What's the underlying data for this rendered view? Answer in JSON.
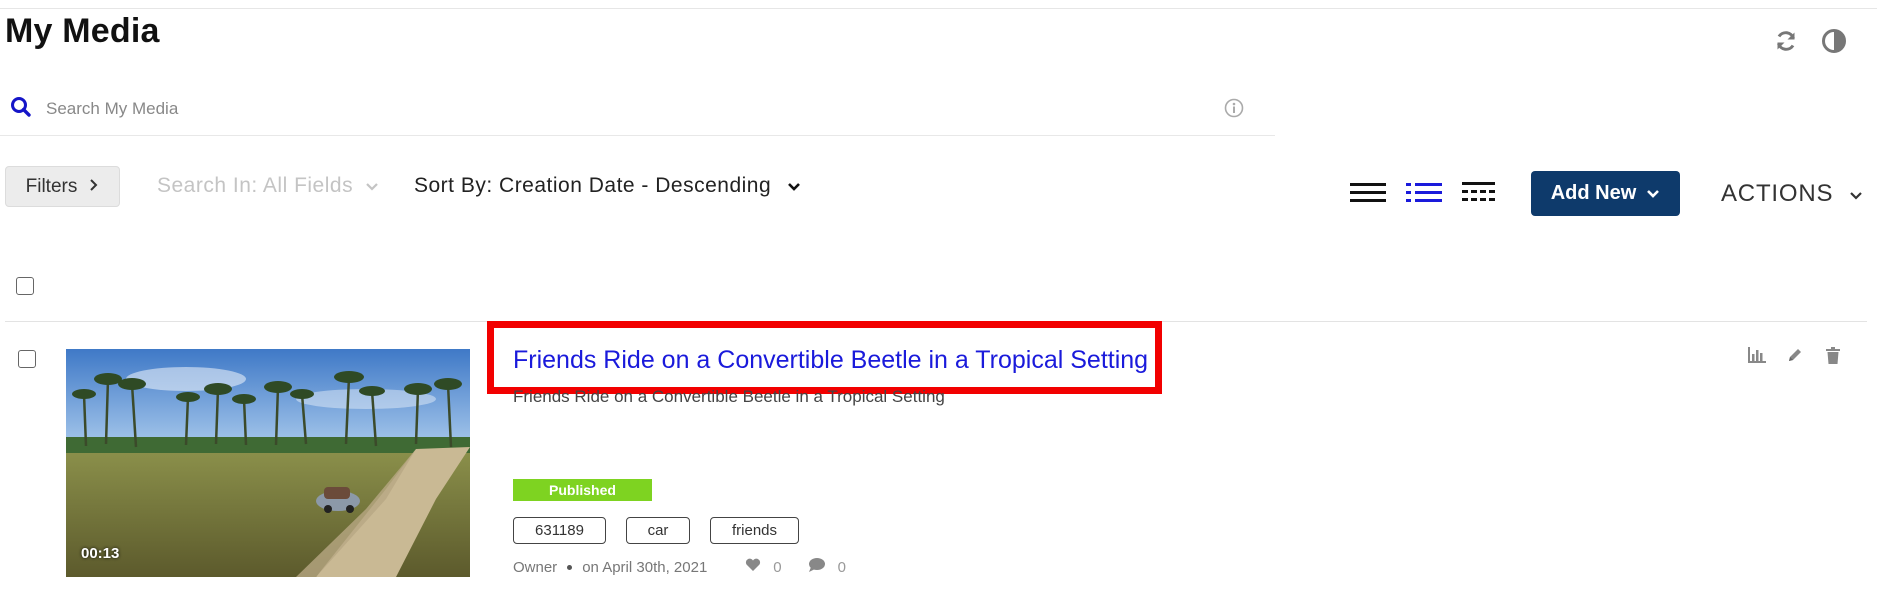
{
  "page": {
    "title": "My Media"
  },
  "header_icons": {
    "refresh": "refresh-icon",
    "contrast": "contrast-icon"
  },
  "search": {
    "placeholder": "Search My Media",
    "value": ""
  },
  "toolbar": {
    "filters_label": "Filters",
    "search_in_label": "Search In: All Fields",
    "sort_by_label": "Sort By: Creation Date - Descending",
    "add_new_label": "Add New",
    "actions_label": "ACTIONS",
    "view_modes": [
      "compact-list",
      "detailed-list",
      "table"
    ],
    "active_view": "detailed-list"
  },
  "colors": {
    "accent": "#0e3a6b",
    "link": "#1a1adb",
    "published": "#7ed321",
    "highlight": "#f20000",
    "active_view": "#1a1adb"
  },
  "media": [
    {
      "title": "Friends Ride on a Convertible Beetle in a Tropical Setting",
      "description": "Friends Ride on a Convertible Beetle in a Tropical Setting",
      "duration": "00:13",
      "status": "Published",
      "tags": [
        "631189",
        "car",
        "friends"
      ],
      "role": "Owner",
      "date": "on April 30th, 2021",
      "likes": "0",
      "comments": "0"
    }
  ]
}
